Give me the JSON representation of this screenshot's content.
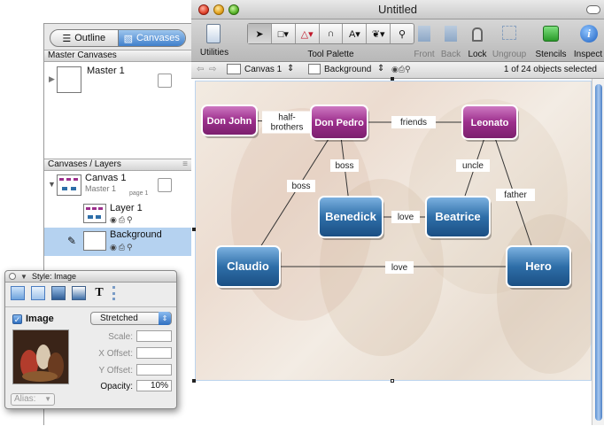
{
  "drawer": {
    "tabs": [
      {
        "label": "Outline",
        "icon": "outline-icon",
        "active": false
      },
      {
        "label": "Canvases",
        "icon": "canvases-icon",
        "active": true
      }
    ],
    "master_header": "Master Canvases",
    "master_name": "Master 1",
    "layers_header": "Canvases / Layers",
    "canvas_name": "Canvas 1",
    "canvas_master": "Master 1",
    "canvas_page": "page 1",
    "layers": [
      {
        "name": "Layer 1",
        "selected": false
      },
      {
        "name": "Background",
        "selected": true
      }
    ]
  },
  "window": {
    "title": "Untitled",
    "toolbar": {
      "utilities": "Utilities",
      "tool_palette": "Tool Palette",
      "front": "Front",
      "back": "Back",
      "lock": "Lock",
      "ungroup": "Ungroup",
      "stencils": "Stencils",
      "inspect": "Inspect"
    },
    "subbar": {
      "canvas": "Canvas 1",
      "layer": "Background",
      "selection": "1 of 24 objects selected"
    }
  },
  "diagram": {
    "nodes": [
      {
        "id": "don-john",
        "label": "Don John",
        "kind": "purple"
      },
      {
        "id": "don-pedro",
        "label": "Don Pedro",
        "kind": "purple"
      },
      {
        "id": "leonato",
        "label": "Leonato",
        "kind": "purple"
      },
      {
        "id": "benedick",
        "label": "Benedick",
        "kind": "blue"
      },
      {
        "id": "beatrice",
        "label": "Beatrice",
        "kind": "blue"
      },
      {
        "id": "claudio",
        "label": "Claudio",
        "kind": "blue"
      },
      {
        "id": "hero",
        "label": "Hero",
        "kind": "blue"
      }
    ],
    "edges": [
      {
        "from": "don-john",
        "to": "don-pedro",
        "label": "half-\nbrothers"
      },
      {
        "from": "don-pedro",
        "to": "leonato",
        "label": "friends"
      },
      {
        "from": "don-pedro",
        "to": "benedick",
        "label": "boss"
      },
      {
        "from": "don-pedro",
        "to": "claudio",
        "label": "boss"
      },
      {
        "from": "leonato",
        "to": "beatrice",
        "label": "uncle"
      },
      {
        "from": "leonato",
        "to": "hero",
        "label": "father"
      },
      {
        "from": "benedick",
        "to": "beatrice",
        "label": "love"
      },
      {
        "from": "claudio",
        "to": "hero",
        "label": "love"
      }
    ]
  },
  "inspector": {
    "title": "Style: Image",
    "image_label": "Image",
    "image_checked": true,
    "mode": "Stretched",
    "scale_label": "Scale:",
    "scale_value": "",
    "x_offset_label": "X Offset:",
    "x_offset_value": "",
    "y_offset_label": "Y Offset:",
    "y_offset_value": "",
    "opacity_label": "Opacity:",
    "opacity_value": "10%",
    "alias_label": "Alias:"
  },
  "colors": {
    "node_purple": "#9c2f8c",
    "node_blue": "#2e6ea8",
    "accent": "#3f7fcb"
  }
}
